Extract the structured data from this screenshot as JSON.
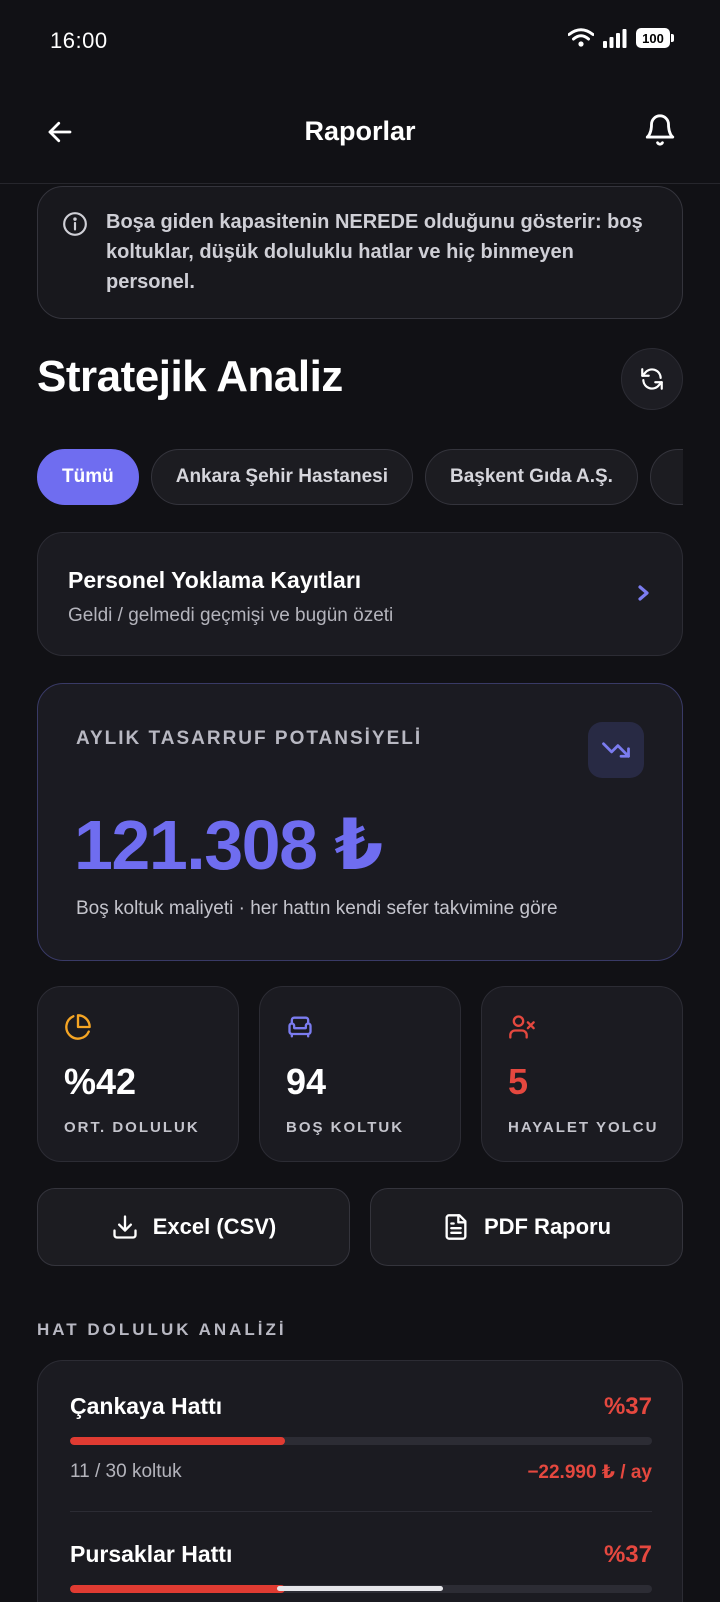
{
  "status_bar": {
    "time": "16:00",
    "battery": "100"
  },
  "header": {
    "title": "Raporlar"
  },
  "info_banner": {
    "text": "Boşa giden kapasitenin NEREDE olduğunu gösterir: boş koltuklar, düşük doluluklu hatlar ve hiç binmeyen personel."
  },
  "section": {
    "title": "Stratejik Analiz"
  },
  "filters": [
    {
      "label": "Tümü",
      "active": true
    },
    {
      "label": "Ankara Şehir Hastanesi",
      "active": false
    },
    {
      "label": "Başkent Gıda A.Ş.",
      "active": false
    },
    {
      "label": "",
      "active": false
    }
  ],
  "attendance_card": {
    "title": "Personel Yoklama Kayıtları",
    "subtitle": "Geldi / gelmedi geçmişi ve bugün özeti"
  },
  "savings": {
    "label": "AYLIK TASARRUF POTANSİYELİ",
    "value": "121.308 ₺",
    "note": "Boş koltuk maliyeti · her hattın kendi sefer takvimine göre"
  },
  "stats": [
    {
      "icon": "pie-chart-icon",
      "value": "%42",
      "label": "ORT. DOLULUK",
      "color": "#f5a524"
    },
    {
      "icon": "armchair-icon",
      "value": "94",
      "label": "BOŞ KOLTUK",
      "color": "#7b7cf0"
    },
    {
      "icon": "user-x-icon",
      "value": "5",
      "label": "HAYALET YOLCU",
      "color": "#e5483f"
    }
  ],
  "export": {
    "excel_label": "Excel (CSV)",
    "pdf_label": "PDF Raporu"
  },
  "lines": {
    "heading": "HAT DOLULUK ANALİZİ",
    "items": [
      {
        "name": "Çankaya Hattı",
        "percent_label": "%37",
        "fill_fraction": 0.37,
        "seats": "11 / 30 koltuk",
        "cost": "−22.990 ₺ / ay"
      },
      {
        "name": "Pursaklar Hattı",
        "percent_label": "%37",
        "fill_fraction": 0.37,
        "seats": "",
        "cost": ""
      }
    ]
  },
  "colors": {
    "accent": "#6f6df0",
    "danger": "#e5483f",
    "warning": "#f5a524",
    "background": "#111115"
  }
}
